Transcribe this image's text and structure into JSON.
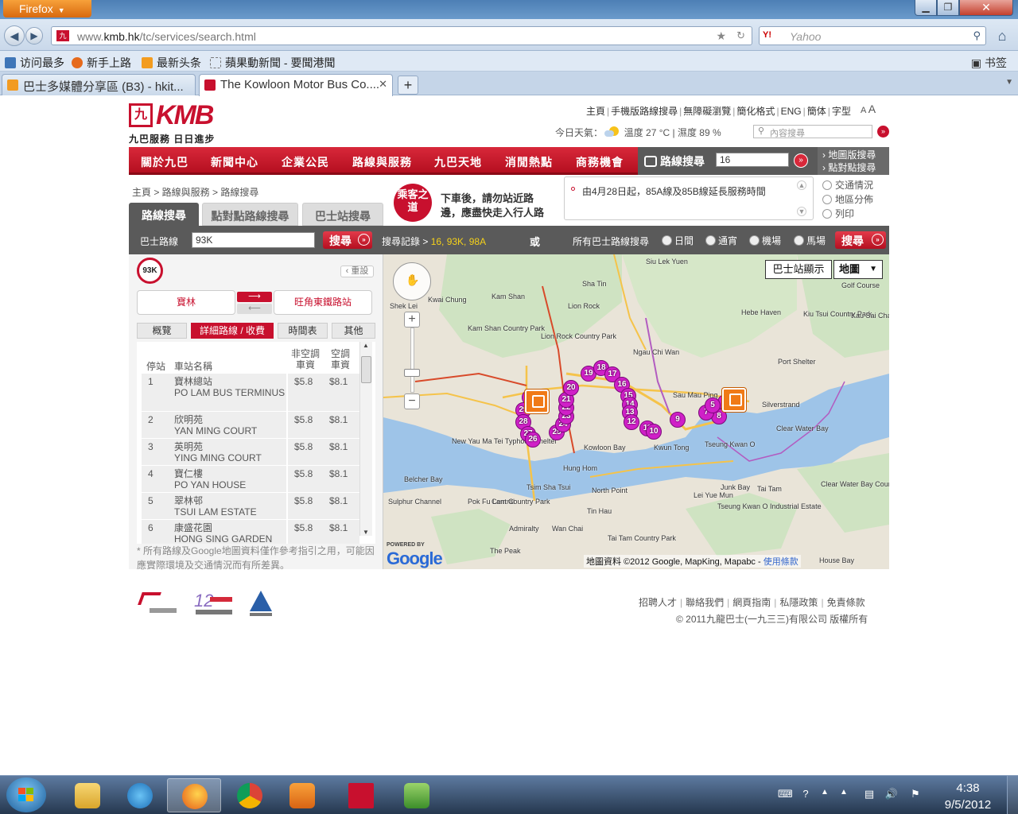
{
  "browser": {
    "app_button": "Firefox",
    "url_prefix": "www.",
    "url_domain": "kmb.hk",
    "url_path": "/tc/services/search.html",
    "search_placeholder": "Yahoo",
    "search_engine_icon": "Y!",
    "bookmarks": [
      "访问最多",
      "新手上路",
      "最新头条",
      "蘋果動新聞 - 要聞港聞"
    ],
    "bookmarks_right": "书签",
    "tabs": [
      {
        "title": "巴士多媒體分享區 (B3) - hkit...",
        "active": false
      },
      {
        "title": "The Kowloon Motor Bus Co....",
        "active": true
      }
    ]
  },
  "header": {
    "logo_mark": "九",
    "logo_text": "KMB",
    "logo_slogan": "九巴服務 日日進步",
    "toplinks": [
      "主頁",
      "手機版路線搜尋",
      "無障礙瀏覽",
      "簡化格式",
      "ENG",
      "簡体",
      "字型"
    ],
    "font_small": "A",
    "font_big": "A",
    "weather_label": "今日天氣：",
    "weather_text": "溫度 27 °C | 濕度 89 %",
    "site_search_placeholder": "內容搜尋"
  },
  "mainnav": {
    "items": [
      "關於九巴",
      "新聞中心",
      "企業公民",
      "路線與服務",
      "九巴天地",
      "消閒熱點",
      "商務機會"
    ],
    "route_search_label": "路線搜尋",
    "route_search_value": "16",
    "side_links": [
      "地圖版搜尋",
      "點對點搜尋"
    ]
  },
  "breadcrumb": "主頁 > 路線與服務 > 路線搜尋",
  "tip": {
    "bubble": "乘客之道",
    "line1": "下車後，請勿站近路",
    "line2": "邊，應盡快走入行人路"
  },
  "notice": "由4月28日起，85A線及85B線延長服務時間",
  "sidelinks": [
    "交通情況",
    "地區分佈",
    "列印"
  ],
  "search_tabs": [
    "路線搜尋",
    "點對點路線搜尋",
    "巴士站搜尋"
  ],
  "searchrow": {
    "route_label": "巴士路線",
    "route_value": "93K",
    "search_btn": "搜尋",
    "history_label": "搜尋記錄 >",
    "history_values": "16, 93K, 98A",
    "or_label": "或",
    "all_label": "所有巴士路線搜尋",
    "radios": [
      "日間",
      "通宵",
      "機場",
      "馬場"
    ]
  },
  "route": {
    "badge": "93K",
    "reset": "重設",
    "from": "寶林",
    "to": "旺角東鐵路站",
    "panel_tabs": [
      "概覽",
      "詳細路線 / 收費",
      "時間表",
      "其他"
    ],
    "col_stop": "停站",
    "col_name": "車站名稱",
    "col_nonac": "非空調車資",
    "col_ac": "空調車資",
    "stops": [
      {
        "no": "1",
        "zh": "寶林總站",
        "en": "PO LAM BUS TERMINUS",
        "f1": "$5.8",
        "f2": "$8.1"
      },
      {
        "no": "2",
        "zh": "欣明苑",
        "en": "YAN MING COURT",
        "f1": "$5.8",
        "f2": "$8.1"
      },
      {
        "no": "3",
        "zh": "英明苑",
        "en": "YING MING COURT",
        "f1": "$5.8",
        "f2": "$8.1"
      },
      {
        "no": "4",
        "zh": "寶仁樓",
        "en": "PO YAN HOUSE",
        "f1": "$5.8",
        "f2": "$8.1"
      },
      {
        "no": "5",
        "zh": "翠林邨",
        "en": "TSUI LAM ESTATE",
        "f1": "$5.8",
        "f2": "$8.1"
      },
      {
        "no": "6",
        "zh": "康盛花園",
        "en": "HONG SING GARDEN",
        "f1": "$5.8",
        "f2": "$8.1"
      }
    ],
    "disclaimer": "* 所有路線及Google地圖資料僅作參考指引之用，可能因應實際環境及交通情況而有所差異。"
  },
  "map": {
    "stop_display_btn": "巴士站顯示",
    "maptype": "地圖",
    "powered_by": "POWERED BY",
    "google": "Google",
    "attribution": "地圖資料 ©2012 Google, MapKing, Mapabc - ",
    "terms": "使用條款",
    "pins": [
      "30",
      "29",
      "28",
      "27",
      "26",
      "25",
      "24",
      "23",
      "22",
      "21",
      "20",
      "19",
      "18",
      "17",
      "16",
      "15",
      "14",
      "13",
      "12",
      "11",
      "10",
      "9",
      "8",
      "7",
      "6",
      "5"
    ],
    "labels": [
      "Siu Lek Yuen",
      "Sha Tin",
      "Kam Shan",
      "Kwai Chung",
      "Lion Rock",
      "Kam Shan Country Park",
      "Lion Rock Country Park",
      "Shek Lei",
      "Ngau Chi Wan",
      "Sau Mau Ping",
      "Kwun Tong",
      "Tseung Kwan O",
      "Hung Hom",
      "Kowloon Bay",
      "Tai Tam",
      "Clear Water Bay",
      "Junk Bay",
      "Port Shelter",
      "Central",
      "Tin Hau",
      "North Point",
      "Wan Chai",
      "Admiralty",
      "The Peak",
      "Sulphur Channel",
      "Belcher Bay",
      "New Yau Ma Tei Typhoon Shelter",
      "Tsim Sha Tsui",
      "Hebe Haven",
      "Kiu Tsui Country Park",
      "Kau Sai Chau",
      "Golf Course",
      "Silverstrand",
      "Lei Yue Mun",
      "Tseung Kwan O Industrial Estate",
      "Pok Fu Lam Country Park",
      "Tai Tam Country Park",
      "Clear Water Bay Country Park",
      "House Bay"
    ]
  },
  "footer": {
    "links": [
      "招聘人才",
      "聯絡我們",
      "網頁指南",
      "私隱政策",
      "免責條款"
    ],
    "copyright": "© 2011九龍巴士(一九三三)有限公司 版權所有"
  },
  "taskbar": {
    "clock_time": "4:38",
    "clock_date": "9/5/2012"
  }
}
